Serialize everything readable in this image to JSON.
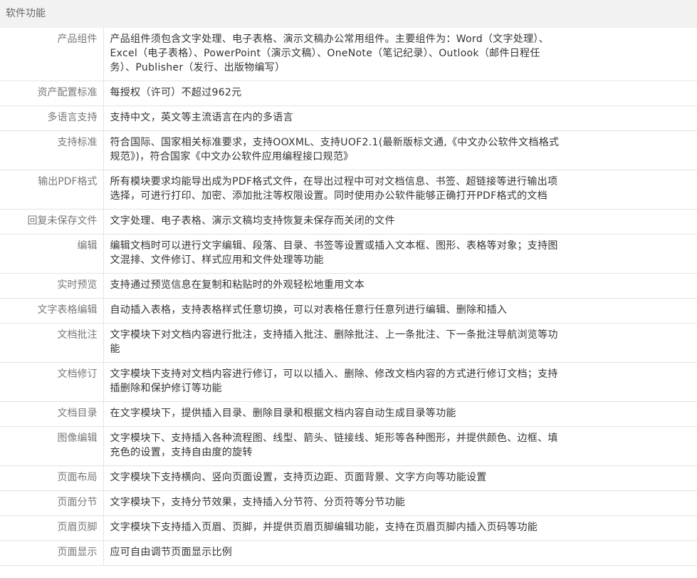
{
  "section_title": "软件功能",
  "rows": [
    {
      "label": "产品组件",
      "value": "产品组件须包含文字处理、电子表格、演示文稿办公常用组件。主要组件为：Word（文字处理）、Excel（电子表格）、PowerPoint（演示文稿）、OneNote（笔记纪录）、Outlook（邮件日程任务）、Publisher（发行、出版物编写）"
    },
    {
      "label": "资产配置标准",
      "value": "每授权（许可）不超过962元"
    },
    {
      "label": "多语言支持",
      "value": "支持中文，英文等主流语言在内的多语言"
    },
    {
      "label": "支持标准",
      "value": "符合国际、国家相关标准要求，支持OOXML、支持UOF2.1(最新版标文通,《中文办公软件文档格式规范》)，符合国家《中文办公软件应用编程接口规范》"
    },
    {
      "label": "输出PDF格式",
      "value": "所有模块要求均能导出成为PDF格式文件，在导出过程中可对文档信息、书签、超链接等进行输出项选择，可进行打印、加密、添加批注等权限设置。同时使用办公软件能够正确打开PDF格式的文档"
    },
    {
      "label": "回复未保存文件",
      "value": "文字处理、电子表格、演示文稿均支持恢复未保存而关闭的文件"
    },
    {
      "label": "编辑",
      "value": "编辑文档时可以进行文字编辑、段落、目录、书签等设置或插入文本框、图形、表格等对象；支持图文混排、文件修订、样式应用和文件处理等功能"
    },
    {
      "label": "实时预览",
      "value": "支持通过预览信息在复制和粘贴时的外观轻松地重用文本"
    },
    {
      "label": "文字表格编辑",
      "value": "自动插入表格，支持表格样式任意切换，可以对表格任意行任意列进行编辑、删除和插入"
    },
    {
      "label": "文档批注",
      "value": "文字模块下对文档内容进行批注，支持插入批注、删除批注、上一条批注、下一条批注导航浏览等功能"
    },
    {
      "label": "文档修订",
      "value": "文字模块下支持对文档内容进行修订，可以以插入、删除、修改文档内容的方式进行修订文档；支持插删除和保护修订等功能"
    },
    {
      "label": "文档目录",
      "value": "在文字模块下，提供插入目录、删除目录和根据文档内容自动生成目录等功能"
    },
    {
      "label": "图像编辑",
      "value": "文字模块下、支持插入各种流程图、线型、箭头、链接线、矩形等各种图形，并提供颜色、边框、填充色的设置，支持自由度的旋转"
    },
    {
      "label": "页面布局",
      "value": "文字模块下支持横向、竖向页面设置，支持页边距、页面背景、文字方向等功能设置"
    },
    {
      "label": "页面分节",
      "value": "文字模块下，支持分节效果，支持插入分节符、分页符等分节功能"
    },
    {
      "label": "页眉页脚",
      "value": "文字模块下支持插入页眉、页脚，并提供页眉页脚编辑功能，支持在页眉页脚内插入页码等功能"
    },
    {
      "label": "页面显示",
      "value": "应可自由调节页面显示比例"
    }
  ]
}
